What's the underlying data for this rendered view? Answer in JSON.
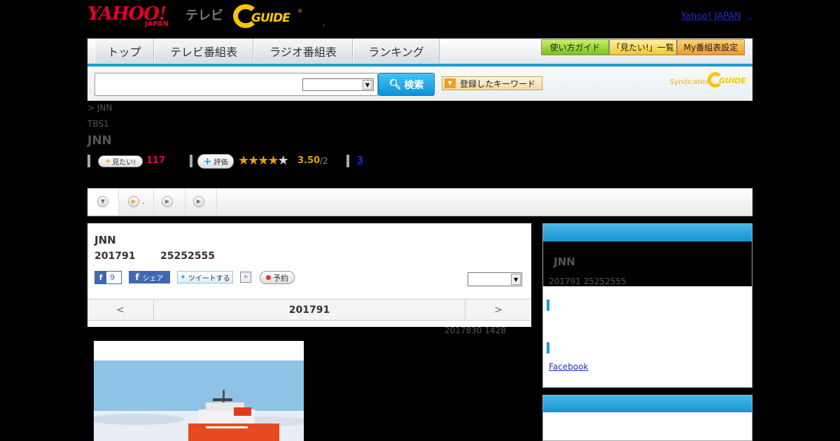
{
  "header": {
    "yahoo_logo_top": "YAHOO!",
    "yahoo_logo_sub": "JAPAN",
    "tv_label": "テレビ",
    "gguide_logo": "GUIDE",
    "gguide_reg": "®",
    "mid_dot": ",",
    "yahoo_japan_link": "Yahoo! JAPAN",
    "yahoo_japan_dot": ","
  },
  "nav": {
    "tabs": [
      "トップ",
      "テレビ番組表",
      "ラジオ番組表",
      "ランキング"
    ],
    "guide_buttons": [
      "使い方ガイド",
      "「見たい!」一覧",
      "My番組表設定"
    ]
  },
  "search": {
    "input_value": "",
    "select_value": "",
    "button_label": "検索",
    "keyword_button": "登録したキーワード",
    "syndicated": "Syndicated",
    "syn_logo": "GUIDE"
  },
  "program": {
    "breadcrumb": "> JNN",
    "station": "TBS1",
    "title": "JNN",
    "mitai_label": "見たい!",
    "mitai_count": "117",
    "hyoka_label": "評価",
    "stars": "★★★★★",
    "rating": "3.50",
    "rating_count": "/2",
    "review_link": "3"
  },
  "tabstrip": {
    "tab2_dot": "."
  },
  "detail": {
    "title": "JNN",
    "date": "201791",
    "time": "25252555",
    "fb_like_count": "9",
    "fb_share": "シェア",
    "tweet": "ツイートする",
    "reserve": "予約",
    "select_value": "",
    "nav_prev": "<",
    "nav_current": "201791",
    "nav_next": ">",
    "updated": "2017830  1428"
  },
  "sidebar": {
    "box_title": "JNN",
    "box_sub": "201791  25252555",
    "facebook_link": "Facebook"
  },
  "colors": {
    "accent_blue": "#1a9cd8",
    "yahoo_red": "#e4002b",
    "gguide_yellow": "#f7c600",
    "mitai_pink": "#e6004c",
    "rating_orange": "#e6a100"
  }
}
